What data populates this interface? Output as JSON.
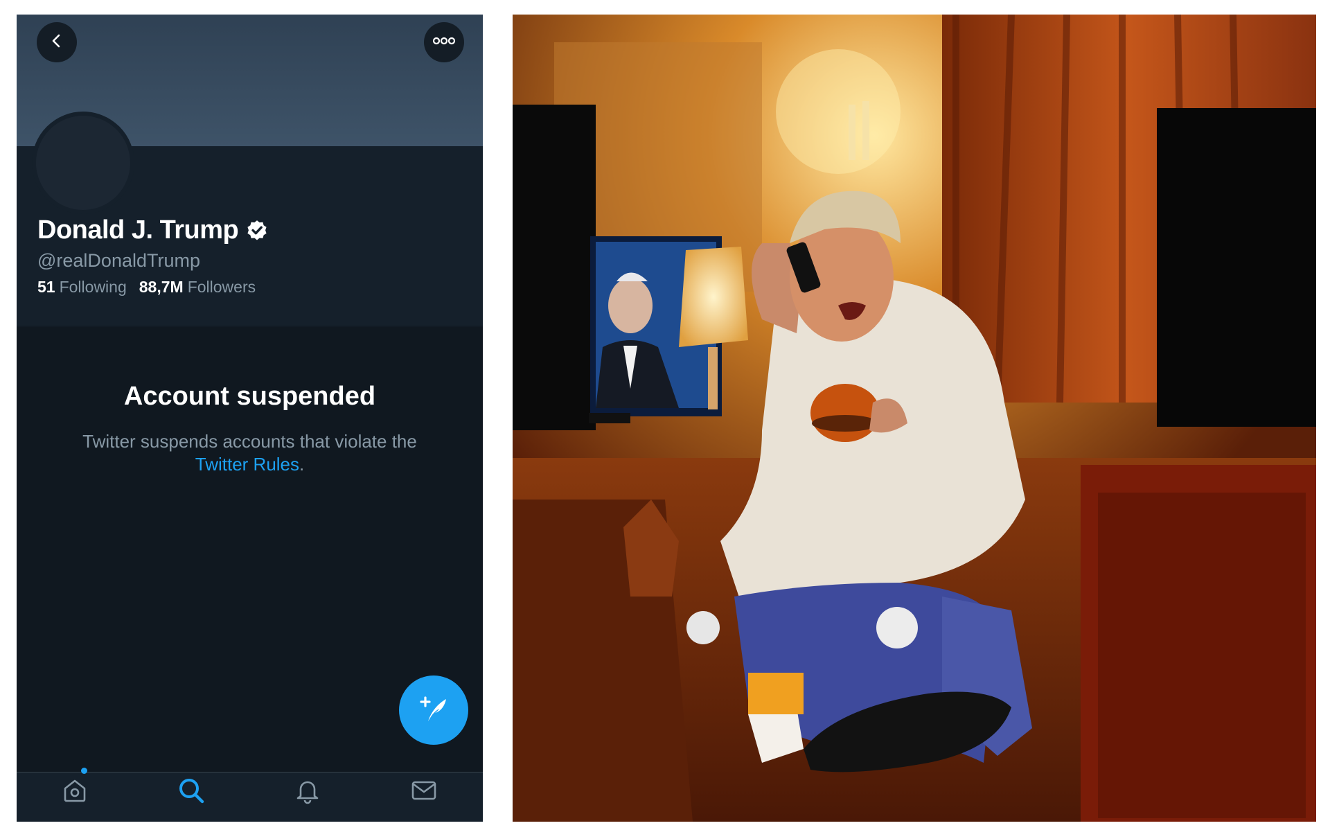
{
  "profile": {
    "name": "Donald J. Trump",
    "handle": "@realDonaldTrump",
    "following_count": "51",
    "following_label": "Following",
    "followers_count": "88,7M",
    "followers_label": "Followers"
  },
  "suspension": {
    "title": "Account suspended",
    "message": "Twitter suspends accounts that violate the",
    "link_text": "Twitter Rules",
    "period": "."
  },
  "icons": {
    "back": "chevron-left-icon",
    "more": "more-horizontal-icon",
    "verified": "verified-badge-icon",
    "compose": "compose-tweet-icon",
    "home": "home-icon",
    "search": "search-icon",
    "notifications": "bell-icon",
    "messages": "mail-icon"
  },
  "colors": {
    "accent": "#1da1f2",
    "background": "#15202b",
    "banner": "#3e5368",
    "secondary_text": "#8899a6"
  },
  "navigation": {
    "active_tab": "search"
  }
}
